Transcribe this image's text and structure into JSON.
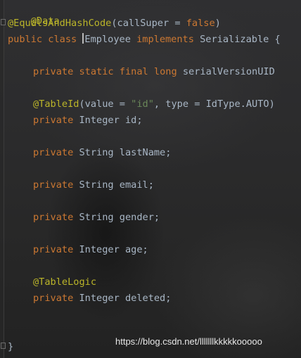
{
  "code": {
    "line1": {
      "annotation": "@Data"
    },
    "line2": {
      "annotation": "@EqualsAndHashCode",
      "open": "(",
      "param": "callSuper = ",
      "value": "false",
      "close": ")"
    },
    "line3": {
      "kw_public": "public",
      "kw_class": "class",
      "name": "Employee",
      "kw_implements": "implements",
      "iface": "Serializable",
      "trail": "{"
    },
    "line4": {
      "kw_private": "private",
      "kw_static": "static",
      "kw_final": "final",
      "kw_long": "long",
      "name": "serialVersionUID"
    },
    "line5": {
      "annotation": "@TableId",
      "open": "(",
      "param1": "value = ",
      "value1": "\"id\"",
      "sep": ", ",
      "param2": "type = IdType.AUTO",
      "close": ")"
    },
    "line6": {
      "kw": "private",
      "rest": "Integer id;"
    },
    "line7": {
      "kw": "private",
      "rest": "String lastName;"
    },
    "line8": {
      "kw": "private",
      "rest": "String email;"
    },
    "line9": {
      "kw": "private",
      "rest": "String gender;"
    },
    "line10": {
      "kw": "private",
      "rest": "Integer age;"
    },
    "line11": {
      "annotation": "@TableLogic"
    },
    "line12": {
      "kw": "private",
      "rest": "Integer deleted;"
    },
    "line13": {
      "brace": "}"
    }
  },
  "colors": {
    "keyword": "#cc7832",
    "annotation": "#bbb529",
    "string": "#6a8759",
    "plain": "#a9b7c6"
  },
  "watermark": "https://blog.csdn.net/lllllllkkkkkooooo"
}
